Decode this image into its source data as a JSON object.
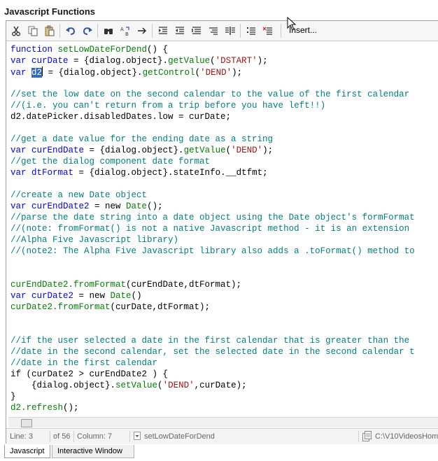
{
  "panel": {
    "title": "Javascript Functions"
  },
  "toolbar": {
    "buttons": [
      {
        "icon": "cut-icon"
      },
      {
        "icon": "copy-icon"
      },
      {
        "icon": "paste-icon"
      },
      {
        "icon": "undo-icon"
      },
      {
        "icon": "redo-icon"
      },
      {
        "icon": "find-icon"
      },
      {
        "icon": "replace-icon"
      },
      {
        "icon": "goto-arrow-icon"
      },
      {
        "icon": "indent-icon"
      },
      {
        "icon": "outdent-icon"
      },
      {
        "icon": "format-icon"
      },
      {
        "icon": "align-right-icon"
      },
      {
        "icon": "split-view-icon"
      },
      {
        "icon": "comment-icon"
      },
      {
        "icon": "uncomment-icon"
      }
    ],
    "insert_label": "Insert..."
  },
  "code_lines": [
    [
      [
        "kw",
        "function "
      ],
      [
        "fn",
        "setLowDateForDend"
      ],
      [
        "tx",
        "() {"
      ]
    ],
    [
      [
        "kw",
        "var "
      ],
      [
        "kw",
        "curDate"
      ],
      [
        "tx",
        " = {dialog.object}."
      ],
      [
        "fn",
        "getValue"
      ],
      [
        "tx",
        "("
      ],
      [
        "str",
        "'DSTART'"
      ],
      [
        "tx",
        ");"
      ]
    ],
    [
      [
        "kw",
        "var "
      ],
      [
        "sel",
        "d2"
      ],
      [
        "tx",
        " = {dialog.object}."
      ],
      [
        "fn",
        "getControl"
      ],
      [
        "tx",
        "("
      ],
      [
        "str",
        "'DEND'"
      ],
      [
        "tx",
        ");"
      ]
    ],
    [],
    [
      [
        "cm",
        "//set the low date on the second calendar to the value of the first calendar"
      ]
    ],
    [
      [
        "cm",
        "//(i.e. you can't return from a trip before you have left!!)"
      ]
    ],
    [
      [
        "tx",
        "d2.datePicker.disabledDates.low = curDate;"
      ]
    ],
    [],
    [
      [
        "cm",
        "//get a date value for the ending date as a string"
      ]
    ],
    [
      [
        "kw",
        "var "
      ],
      [
        "kw",
        "curEndDate"
      ],
      [
        "tx",
        " = {dialog.object}."
      ],
      [
        "fn",
        "getValue"
      ],
      [
        "tx",
        "("
      ],
      [
        "str",
        "'DEND'"
      ],
      [
        "tx",
        ");"
      ]
    ],
    [
      [
        "cm",
        "//get the dialog component date format"
      ]
    ],
    [
      [
        "kw",
        "var "
      ],
      [
        "kw",
        "dtFormat"
      ],
      [
        "tx",
        " = {dialog.object}.stateInfo.__dtfmt;"
      ]
    ],
    [],
    [
      [
        "cm",
        "//create a new Date object"
      ]
    ],
    [
      [
        "kw",
        "var "
      ],
      [
        "kw",
        "curEndDate2"
      ],
      [
        "tx",
        " = new "
      ],
      [
        "fn",
        "Date"
      ],
      [
        "tx",
        "();"
      ]
    ],
    [
      [
        "cm",
        "//parse the date string into a date object using the Date object's formFormat"
      ]
    ],
    [
      [
        "cm",
        "//(note: fromFormat() is not a native Javascript method - it is an extension"
      ]
    ],
    [
      [
        "cm",
        "//Alpha Five Javascript library)"
      ]
    ],
    [
      [
        "cm",
        "//(note2: The Alpha Five Javascript library also adds a .toFormat() method to"
      ]
    ],
    [],
    [],
    [
      [
        "fn",
        "curEndDate2.fromFormat"
      ],
      [
        "tx",
        "(curEndDate,dtFormat);"
      ]
    ],
    [
      [
        "kw",
        "var "
      ],
      [
        "kw",
        "curDate2"
      ],
      [
        "tx",
        " = new "
      ],
      [
        "fn",
        "Date"
      ],
      [
        "tx",
        "()"
      ]
    ],
    [
      [
        "fn",
        "curDate2.fromFormat"
      ],
      [
        "tx",
        "(curDate,dtFormat);"
      ]
    ],
    [],
    [],
    [
      [
        "cm",
        "//if the user selected a date in the first calendar that is greater than the"
      ]
    ],
    [
      [
        "cm",
        "//date in the second calendar, set the selected date in the second calendar t"
      ]
    ],
    [
      [
        "cm",
        "//date in the first calendar"
      ]
    ],
    [
      [
        "tx",
        "if (curDate2 > curEndDate2 ) {"
      ]
    ],
    [
      [
        "tx",
        "    {dialog.object}."
      ],
      [
        "fn",
        "setValue"
      ],
      [
        "tx",
        "("
      ],
      [
        "str",
        "'DEND'"
      ],
      [
        "tx",
        ",curDate);"
      ]
    ],
    [
      [
        "tx",
        "}"
      ]
    ],
    [
      [
        "fn",
        "d2.refresh"
      ],
      [
        "tx",
        "();"
      ]
    ]
  ],
  "status": {
    "line": "Line: 3",
    "of": "of 56",
    "column": "Column: 7",
    "function_name": "setLowDateForDend",
    "path": "C:\\V10VideosHome"
  },
  "tabs": [
    {
      "label": "Javascript"
    },
    {
      "label": "Interactive Window"
    }
  ]
}
